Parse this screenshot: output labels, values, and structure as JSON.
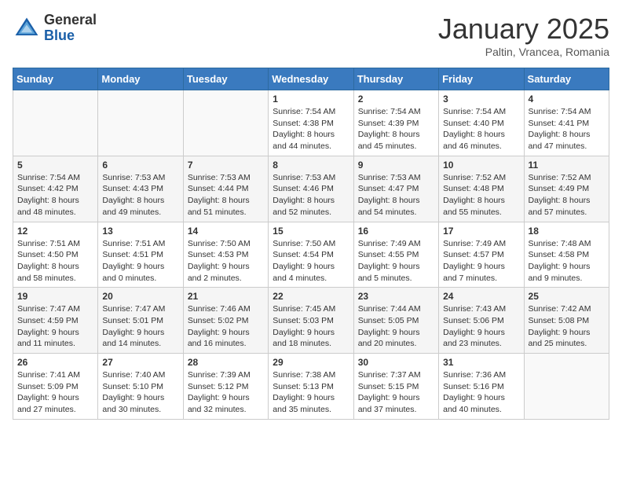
{
  "header": {
    "logo_line1": "General",
    "logo_line2": "Blue",
    "month": "January 2025",
    "location": "Paltin, Vrancea, Romania"
  },
  "weekdays": [
    "Sunday",
    "Monday",
    "Tuesday",
    "Wednesday",
    "Thursday",
    "Friday",
    "Saturday"
  ],
  "weeks": [
    [
      {
        "day": "",
        "sunrise": "",
        "sunset": "",
        "daylight": ""
      },
      {
        "day": "",
        "sunrise": "",
        "sunset": "",
        "daylight": ""
      },
      {
        "day": "",
        "sunrise": "",
        "sunset": "",
        "daylight": ""
      },
      {
        "day": "1",
        "sunrise": "Sunrise: 7:54 AM",
        "sunset": "Sunset: 4:38 PM",
        "daylight": "Daylight: 8 hours and 44 minutes."
      },
      {
        "day": "2",
        "sunrise": "Sunrise: 7:54 AM",
        "sunset": "Sunset: 4:39 PM",
        "daylight": "Daylight: 8 hours and 45 minutes."
      },
      {
        "day": "3",
        "sunrise": "Sunrise: 7:54 AM",
        "sunset": "Sunset: 4:40 PM",
        "daylight": "Daylight: 8 hours and 46 minutes."
      },
      {
        "day": "4",
        "sunrise": "Sunrise: 7:54 AM",
        "sunset": "Sunset: 4:41 PM",
        "daylight": "Daylight: 8 hours and 47 minutes."
      }
    ],
    [
      {
        "day": "5",
        "sunrise": "Sunrise: 7:54 AM",
        "sunset": "Sunset: 4:42 PM",
        "daylight": "Daylight: 8 hours and 48 minutes."
      },
      {
        "day": "6",
        "sunrise": "Sunrise: 7:53 AM",
        "sunset": "Sunset: 4:43 PM",
        "daylight": "Daylight: 8 hours and 49 minutes."
      },
      {
        "day": "7",
        "sunrise": "Sunrise: 7:53 AM",
        "sunset": "Sunset: 4:44 PM",
        "daylight": "Daylight: 8 hours and 51 minutes."
      },
      {
        "day": "8",
        "sunrise": "Sunrise: 7:53 AM",
        "sunset": "Sunset: 4:46 PM",
        "daylight": "Daylight: 8 hours and 52 minutes."
      },
      {
        "day": "9",
        "sunrise": "Sunrise: 7:53 AM",
        "sunset": "Sunset: 4:47 PM",
        "daylight": "Daylight: 8 hours and 54 minutes."
      },
      {
        "day": "10",
        "sunrise": "Sunrise: 7:52 AM",
        "sunset": "Sunset: 4:48 PM",
        "daylight": "Daylight: 8 hours and 55 minutes."
      },
      {
        "day": "11",
        "sunrise": "Sunrise: 7:52 AM",
        "sunset": "Sunset: 4:49 PM",
        "daylight": "Daylight: 8 hours and 57 minutes."
      }
    ],
    [
      {
        "day": "12",
        "sunrise": "Sunrise: 7:51 AM",
        "sunset": "Sunset: 4:50 PM",
        "daylight": "Daylight: 8 hours and 58 minutes."
      },
      {
        "day": "13",
        "sunrise": "Sunrise: 7:51 AM",
        "sunset": "Sunset: 4:51 PM",
        "daylight": "Daylight: 9 hours and 0 minutes."
      },
      {
        "day": "14",
        "sunrise": "Sunrise: 7:50 AM",
        "sunset": "Sunset: 4:53 PM",
        "daylight": "Daylight: 9 hours and 2 minutes."
      },
      {
        "day": "15",
        "sunrise": "Sunrise: 7:50 AM",
        "sunset": "Sunset: 4:54 PM",
        "daylight": "Daylight: 9 hours and 4 minutes."
      },
      {
        "day": "16",
        "sunrise": "Sunrise: 7:49 AM",
        "sunset": "Sunset: 4:55 PM",
        "daylight": "Daylight: 9 hours and 5 minutes."
      },
      {
        "day": "17",
        "sunrise": "Sunrise: 7:49 AM",
        "sunset": "Sunset: 4:57 PM",
        "daylight": "Daylight: 9 hours and 7 minutes."
      },
      {
        "day": "18",
        "sunrise": "Sunrise: 7:48 AM",
        "sunset": "Sunset: 4:58 PM",
        "daylight": "Daylight: 9 hours and 9 minutes."
      }
    ],
    [
      {
        "day": "19",
        "sunrise": "Sunrise: 7:47 AM",
        "sunset": "Sunset: 4:59 PM",
        "daylight": "Daylight: 9 hours and 11 minutes."
      },
      {
        "day": "20",
        "sunrise": "Sunrise: 7:47 AM",
        "sunset": "Sunset: 5:01 PM",
        "daylight": "Daylight: 9 hours and 14 minutes."
      },
      {
        "day": "21",
        "sunrise": "Sunrise: 7:46 AM",
        "sunset": "Sunset: 5:02 PM",
        "daylight": "Daylight: 9 hours and 16 minutes."
      },
      {
        "day": "22",
        "sunrise": "Sunrise: 7:45 AM",
        "sunset": "Sunset: 5:03 PM",
        "daylight": "Daylight: 9 hours and 18 minutes."
      },
      {
        "day": "23",
        "sunrise": "Sunrise: 7:44 AM",
        "sunset": "Sunset: 5:05 PM",
        "daylight": "Daylight: 9 hours and 20 minutes."
      },
      {
        "day": "24",
        "sunrise": "Sunrise: 7:43 AM",
        "sunset": "Sunset: 5:06 PM",
        "daylight": "Daylight: 9 hours and 23 minutes."
      },
      {
        "day": "25",
        "sunrise": "Sunrise: 7:42 AM",
        "sunset": "Sunset: 5:08 PM",
        "daylight": "Daylight: 9 hours and 25 minutes."
      }
    ],
    [
      {
        "day": "26",
        "sunrise": "Sunrise: 7:41 AM",
        "sunset": "Sunset: 5:09 PM",
        "daylight": "Daylight: 9 hours and 27 minutes."
      },
      {
        "day": "27",
        "sunrise": "Sunrise: 7:40 AM",
        "sunset": "Sunset: 5:10 PM",
        "daylight": "Daylight: 9 hours and 30 minutes."
      },
      {
        "day": "28",
        "sunrise": "Sunrise: 7:39 AM",
        "sunset": "Sunset: 5:12 PM",
        "daylight": "Daylight: 9 hours and 32 minutes."
      },
      {
        "day": "29",
        "sunrise": "Sunrise: 7:38 AM",
        "sunset": "Sunset: 5:13 PM",
        "daylight": "Daylight: 9 hours and 35 minutes."
      },
      {
        "day": "30",
        "sunrise": "Sunrise: 7:37 AM",
        "sunset": "Sunset: 5:15 PM",
        "daylight": "Daylight: 9 hours and 37 minutes."
      },
      {
        "day": "31",
        "sunrise": "Sunrise: 7:36 AM",
        "sunset": "Sunset: 5:16 PM",
        "daylight": "Daylight: 9 hours and 40 minutes."
      },
      {
        "day": "",
        "sunrise": "",
        "sunset": "",
        "daylight": ""
      }
    ]
  ]
}
